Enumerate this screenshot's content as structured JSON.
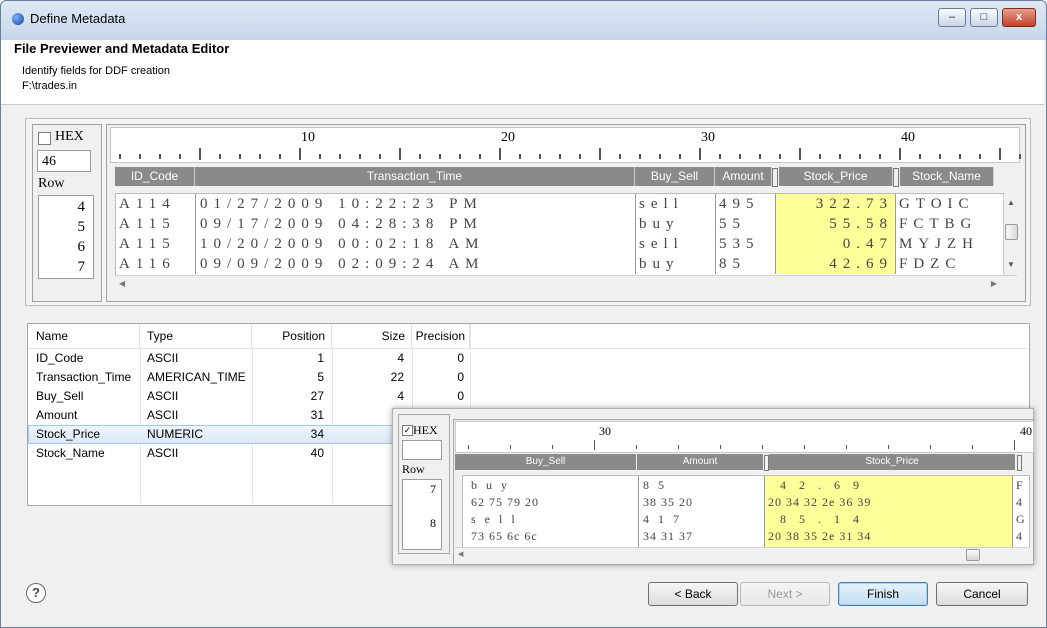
{
  "window": {
    "title": "Define Metadata",
    "minimize": "–",
    "maximize": "□",
    "close": "x"
  },
  "header": {
    "title": "File Previewer and Metadata Editor",
    "subtitle": "Identify fields for DDF creation",
    "path": "F:\\trades.in"
  },
  "preview": {
    "hex_label": "HEX",
    "hex_checked": false,
    "offset_value": "46",
    "row_label": "Row",
    "row_numbers": [
      "4",
      "5",
      "6",
      "7"
    ],
    "ruler_labels": [
      "10",
      "20",
      "30",
      "40"
    ],
    "columns": [
      "ID_Code",
      "Transaction_Time",
      "Buy_Sell",
      "Amount",
      "Stock_Price",
      "Stock_Name"
    ],
    "rows": [
      {
        "id": "A114",
        "time": "01/27/2009 10:22:23 PM",
        "bs": "sell",
        "amt": "495",
        "price": "322.73",
        "name": "GTOIC"
      },
      {
        "id": "A115",
        "time": "09/17/2009 04:28:38 PM",
        "bs": "buy",
        "amt": "55",
        "price": "55.58",
        "name": "FCTBG"
      },
      {
        "id": "A115",
        "time": "10/20/2009 00:02:18 AM",
        "bs": "sell",
        "amt": "535",
        "price": "0.47",
        "name": "MYJZH"
      },
      {
        "id": "A116",
        "time": "09/09/2009 02:09:24 AM",
        "bs": "buy",
        "amt": "85",
        "price": "42.69",
        "name": "FDZC"
      }
    ]
  },
  "metadata": {
    "headers": [
      "Name",
      "Type",
      "Position",
      "Size",
      "Precision"
    ],
    "rows": [
      {
        "name": "ID_Code",
        "type": "ASCII",
        "position": "1",
        "size": "4",
        "precision": "0"
      },
      {
        "name": "Transaction_Time",
        "type": "AMERICAN_TIME",
        "position": "5",
        "size": "22",
        "precision": "0"
      },
      {
        "name": "Buy_Sell",
        "type": "ASCII",
        "position": "27",
        "size": "4",
        "precision": "0"
      },
      {
        "name": "Amount",
        "type": "ASCII",
        "position": "31",
        "size": "",
        "precision": ""
      },
      {
        "name": "Stock_Price",
        "type": "NUMERIC",
        "position": "34",
        "size": "",
        "precision": ""
      },
      {
        "name": "Stock_Name",
        "type": "ASCII",
        "position": "40",
        "size": "",
        "precision": ""
      }
    ]
  },
  "hexview": {
    "hex_label": "HEX",
    "hex_checked": true,
    "row_label": "Row",
    "row_numbers": [
      "7",
      "8"
    ],
    "ruler_labels": [
      "30",
      "40"
    ],
    "columns": [
      "Buy_Sell",
      "Amount",
      "Stock_Price"
    ],
    "lines": [
      {
        "bs": "b  u  y",
        "amt": "8  5",
        "price": "   4   2   .   6   9",
        "tail": "F"
      },
      {
        "bs": "62 75 79 20",
        "amt": "38 35 20",
        "price": "20 34 32 2e 36 39",
        "tail": "4"
      },
      {
        "bs": "s  e  l  l",
        "amt": "4  1  7",
        "price": "   8   5   .   1   4",
        "tail": "G"
      },
      {
        "bs": "73 65 6c 6c",
        "amt": "34 31 37",
        "price": "20 38 35 2e 31 34",
        "tail": "4"
      }
    ]
  },
  "buttons": {
    "help": "?",
    "back": "< Back",
    "next": "Next >",
    "finish": "Finish",
    "cancel": "Cancel"
  },
  "colors": {
    "highlight": "#ffff99",
    "header_gray": "#8a8a8a",
    "selection": "#d9e8f8"
  }
}
